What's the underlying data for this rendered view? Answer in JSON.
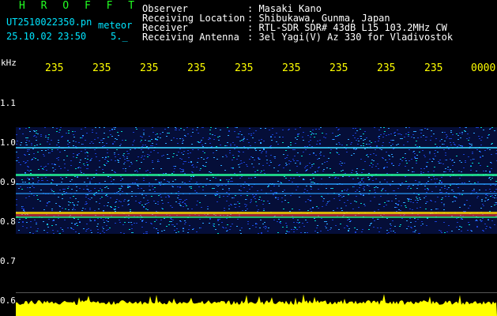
{
  "app": {
    "name": "H R O F F T"
  },
  "file": {
    "name": "UT2510022350.pn",
    "suffix": "meteor"
  },
  "timestamp": {
    "date_time": "25.10.02 23:50",
    "extra": "5._"
  },
  "station": {
    "observer_label": "Observer",
    "observer_value": ": Masaki Kano",
    "location_label": "Receiving Location",
    "location_value": ": Shibukawa, Gunma, Japan",
    "receiver_label": "Receiver",
    "receiver_value": ": RTL-SDR SDR# 43dB L15 103.2MHz CW",
    "antenna_label": "Receiving Antenna",
    "antenna_value": ": 3el Yagi(V) Az 330 for Vladivostok"
  },
  "axis": {
    "unit": "kHz",
    "freq_labels": [
      "1.1",
      "1.0",
      "0.9",
      "0.8",
      "0.7",
      "0.6"
    ],
    "time_labels": [
      "235",
      "235",
      "235",
      "235",
      "235",
      "235",
      "235",
      "235",
      "235",
      "0000"
    ]
  },
  "colors": {
    "title": "#22ff22",
    "timeaxis": "#ffff00",
    "filename": "#00e5ff"
  }
}
